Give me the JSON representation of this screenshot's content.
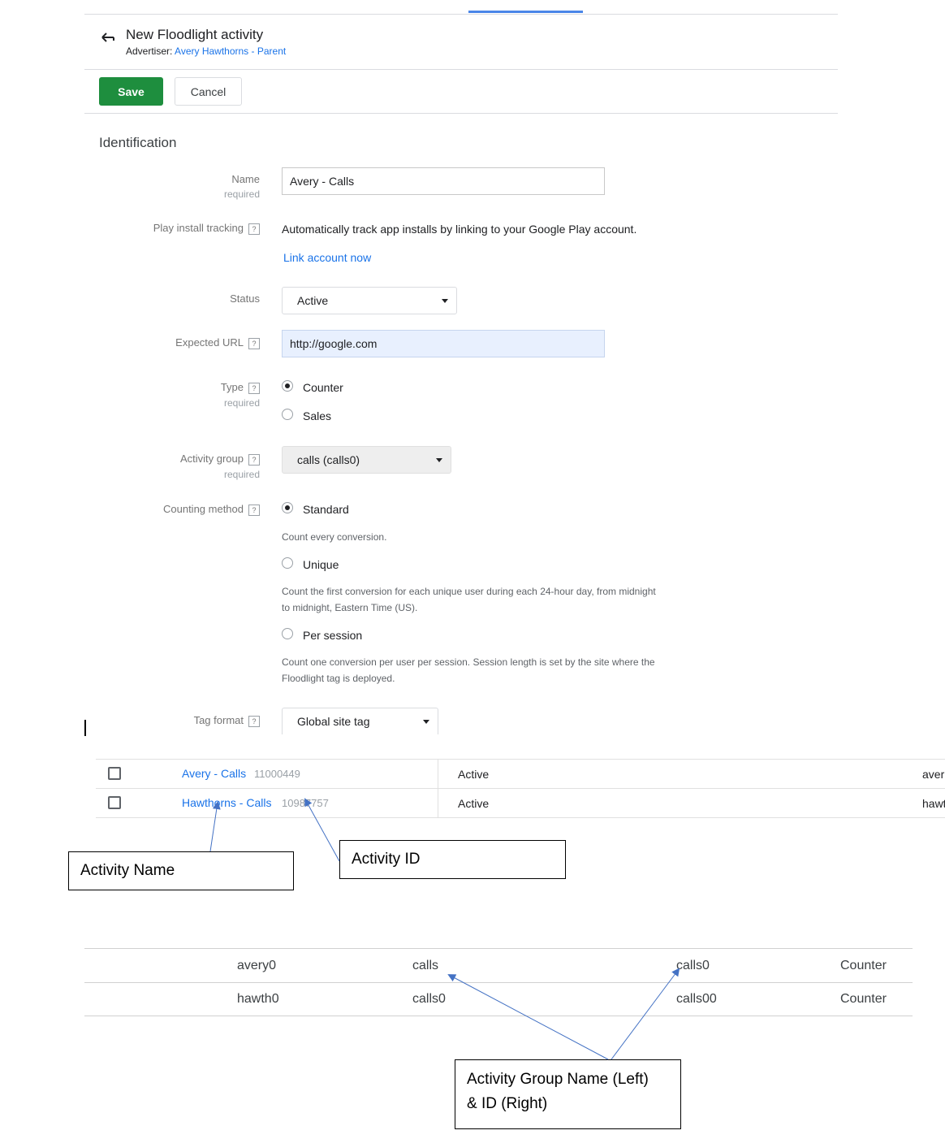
{
  "header": {
    "title": "New Floodlight activity",
    "advertiser_label": "Advertiser:",
    "advertiser_name": "Avery Hawthorns - Parent"
  },
  "toolbar": {
    "save_label": "Save",
    "cancel_label": "Cancel"
  },
  "form": {
    "section_title": "Identification",
    "required_text": "required",
    "name": {
      "label": "Name",
      "value": "Avery - Calls"
    },
    "play_install": {
      "label": "Play install tracking",
      "text": "Automatically track app installs by linking to your Google Play account.",
      "link": "Link account now"
    },
    "status": {
      "label": "Status",
      "value": "Active"
    },
    "expected_url": {
      "label": "Expected URL",
      "value": "http://google.com"
    },
    "type": {
      "label": "Type",
      "options": [
        "Counter",
        "Sales"
      ],
      "selected": "Counter"
    },
    "activity_group": {
      "label": "Activity group",
      "value": "calls (calls0)"
    },
    "counting_method": {
      "label": "Counting method",
      "options": [
        {
          "label": "Standard",
          "desc": "Count every conversion.",
          "selected": true
        },
        {
          "label": "Unique",
          "desc": "Count the first conversion for each unique user during each 24-hour day, from midnight to midnight, Eastern Time (US).",
          "selected": false
        },
        {
          "label": "Per session",
          "desc": "Count one conversion per user per session. Session length is set by the site where the Floodlight tag is deployed.",
          "selected": false
        }
      ]
    },
    "tag_format": {
      "label": "Tag format",
      "value": "Global site tag"
    },
    "help_glyph": "?"
  },
  "activities_table": {
    "rows": [
      {
        "name": "Avery - Calls",
        "id": "11000449",
        "status": "Active",
        "extra": "aver"
      },
      {
        "name": "Hawthorns - Calls",
        "id": "10987757",
        "status": "Active",
        "extra": "hawt"
      }
    ]
  },
  "groups_table": {
    "rows": [
      {
        "col1": "avery0",
        "col2": "calls",
        "col3": "calls0",
        "col4": "Counter"
      },
      {
        "col1": "hawth0",
        "col2": "calls0",
        "col3": "calls00",
        "col4": "Counter"
      }
    ]
  },
  "callouts": {
    "activity_name": "Activity Name",
    "activity_id": "Activity ID",
    "group_line1": "Activity Group Name (Left)",
    "group_line2": "& ID (Right)"
  },
  "colors": {
    "save_green": "#1e8e3e",
    "link_blue": "#1a73e8",
    "arrow_blue": "#4472c4"
  }
}
